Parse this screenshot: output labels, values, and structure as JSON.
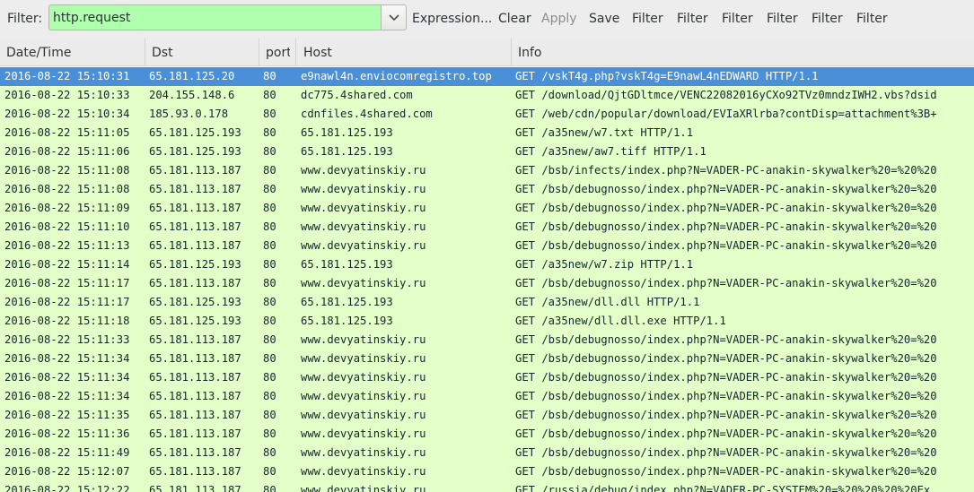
{
  "toolbar": {
    "filter_label": "Filter:",
    "filter_value": "http.request",
    "buttons": {
      "expression": "Expression...",
      "clear": "Clear",
      "apply": "Apply",
      "save": "Save",
      "filter1": "Filter",
      "filter2": "Filter",
      "filter3": "Filter",
      "filter4": "Filter",
      "filter5": "Filter",
      "filter6": "Filter"
    }
  },
  "columns": {
    "time": "Date/Time",
    "dst": "Dst",
    "port": "port",
    "host": "Host",
    "info": "Info"
  },
  "colors": {
    "filter_valid": "#afffaf",
    "row_http": "#e4ffc7",
    "row_selected": "#4a90d9"
  },
  "rows": [
    {
      "time": "2016-08-22 15:10:31",
      "dst": "65.181.125.20",
      "port": "80",
      "host": "e9nawl4n.enviocomregistro.top",
      "info": "GET /vskT4g.php?vskT4g=E9nawL4nEDWARD HTTP/1.1"
    },
    {
      "time": "2016-08-22 15:10:33",
      "dst": "204.155.148.6",
      "port": "80",
      "host": "dc775.4shared.com",
      "info": "GET /download/QjtGDltmce/VENC22082016yCXo92TVz0mndzIWH2.vbs?dsid"
    },
    {
      "time": "2016-08-22 15:10:34",
      "dst": "185.93.0.178",
      "port": "80",
      "host": "cdnfiles.4shared.com",
      "info": "GET /web/cdn/popular/download/EVIaXRlrba?contDisp=attachment%3B+"
    },
    {
      "time": "2016-08-22 15:11:05",
      "dst": "65.181.125.193",
      "port": "80",
      "host": "65.181.125.193",
      "info": "GET /a35new/w7.txt HTTP/1.1"
    },
    {
      "time": "2016-08-22 15:11:06",
      "dst": "65.181.125.193",
      "port": "80",
      "host": "65.181.125.193",
      "info": "GET /a35new/aw7.tiff HTTP/1.1"
    },
    {
      "time": "2016-08-22 15:11:08",
      "dst": "65.181.113.187",
      "port": "80",
      "host": "www.devyatinskiy.ru",
      "info": "GET /bsb/infects/index.php?N=VADER-PC-anakin-skywalker%20=%20%20"
    },
    {
      "time": "2016-08-22 15:11:08",
      "dst": "65.181.113.187",
      "port": "80",
      "host": "www.devyatinskiy.ru",
      "info": "GET /bsb/debugnosso/index.php?N=VADER-PC-anakin-skywalker%20=%20"
    },
    {
      "time": "2016-08-22 15:11:09",
      "dst": "65.181.113.187",
      "port": "80",
      "host": "www.devyatinskiy.ru",
      "info": "GET /bsb/debugnosso/index.php?N=VADER-PC-anakin-skywalker%20=%20"
    },
    {
      "time": "2016-08-22 15:11:10",
      "dst": "65.181.113.187",
      "port": "80",
      "host": "www.devyatinskiy.ru",
      "info": "GET /bsb/debugnosso/index.php?N=VADER-PC-anakin-skywalker%20=%20"
    },
    {
      "time": "2016-08-22 15:11:13",
      "dst": "65.181.113.187",
      "port": "80",
      "host": "www.devyatinskiy.ru",
      "info": "GET /bsb/debugnosso/index.php?N=VADER-PC-anakin-skywalker%20=%20"
    },
    {
      "time": "2016-08-22 15:11:14",
      "dst": "65.181.125.193",
      "port": "80",
      "host": "65.181.125.193",
      "info": "GET /a35new/w7.zip HTTP/1.1"
    },
    {
      "time": "2016-08-22 15:11:17",
      "dst": "65.181.113.187",
      "port": "80",
      "host": "www.devyatinskiy.ru",
      "info": "GET /bsb/debugnosso/index.php?N=VADER-PC-anakin-skywalker%20=%20"
    },
    {
      "time": "2016-08-22 15:11:17",
      "dst": "65.181.125.193",
      "port": "80",
      "host": "65.181.125.193",
      "info": "GET /a35new/dll.dll HTTP/1.1"
    },
    {
      "time": "2016-08-22 15:11:18",
      "dst": "65.181.125.193",
      "port": "80",
      "host": "65.181.125.193",
      "info": "GET /a35new/dll.dll.exe HTTP/1.1"
    },
    {
      "time": "2016-08-22 15:11:33",
      "dst": "65.181.113.187",
      "port": "80",
      "host": "www.devyatinskiy.ru",
      "info": "GET /bsb/debugnosso/index.php?N=VADER-PC-anakin-skywalker%20=%20"
    },
    {
      "time": "2016-08-22 15:11:34",
      "dst": "65.181.113.187",
      "port": "80",
      "host": "www.devyatinskiy.ru",
      "info": "GET /bsb/debugnosso/index.php?N=VADER-PC-anakin-skywalker%20=%20"
    },
    {
      "time": "2016-08-22 15:11:34",
      "dst": "65.181.113.187",
      "port": "80",
      "host": "www.devyatinskiy.ru",
      "info": "GET /bsb/debugnosso/index.php?N=VADER-PC-anakin-skywalker%20=%20"
    },
    {
      "time": "2016-08-22 15:11:34",
      "dst": "65.181.113.187",
      "port": "80",
      "host": "www.devyatinskiy.ru",
      "info": "GET /bsb/debugnosso/index.php?N=VADER-PC-anakin-skywalker%20=%20"
    },
    {
      "time": "2016-08-22 15:11:35",
      "dst": "65.181.113.187",
      "port": "80",
      "host": "www.devyatinskiy.ru",
      "info": "GET /bsb/debugnosso/index.php?N=VADER-PC-anakin-skywalker%20=%20"
    },
    {
      "time": "2016-08-22 15:11:36",
      "dst": "65.181.113.187",
      "port": "80",
      "host": "www.devyatinskiy.ru",
      "info": "GET /bsb/debugnosso/index.php?N=VADER-PC-anakin-skywalker%20=%20"
    },
    {
      "time": "2016-08-22 15:11:49",
      "dst": "65.181.113.187",
      "port": "80",
      "host": "www.devyatinskiy.ru",
      "info": "GET /bsb/debugnosso/index.php?N=VADER-PC-anakin-skywalker%20=%20"
    },
    {
      "time": "2016-08-22 15:12:07",
      "dst": "65.181.113.187",
      "port": "80",
      "host": "www.devyatinskiy.ru",
      "info": "GET /bsb/debugnosso/index.php?N=VADER-PC-anakin-skywalker%20=%20"
    },
    {
      "time": "2016-08-22 15:12:22",
      "dst": "65.181.113.187",
      "port": "80",
      "host": "www.devyatinskiy.ru",
      "info": "GET /russia/debug/index.php?N=VADER-PC-SYSTEM%20=%20%20%20%20Ex"
    }
  ]
}
